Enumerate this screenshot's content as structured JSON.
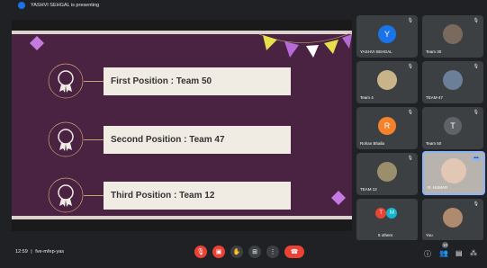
{
  "presenting": {
    "text": "YASHVI SEHGAL is presenting"
  },
  "slide": {
    "positions": [
      {
        "label": "First Position : Team 50",
        "numeral": "I"
      },
      {
        "label": "Second Position : Team 47",
        "numeral": "II"
      },
      {
        "label": "Third Position : Team 12",
        "numeral": "III"
      }
    ]
  },
  "participants": [
    {
      "name": "YASHVI SEHGAL",
      "initial": "Y",
      "color": "#1a73e8"
    },
    {
      "name": "Team 30",
      "initial": ""
    },
    {
      "name": "Team 4",
      "initial": ""
    },
    {
      "name": "TEAM-47",
      "initial": ""
    },
    {
      "name": "Rohan Bhalla",
      "initial": "R",
      "color": "#f4822a"
    },
    {
      "name": "Team 50",
      "initial": "T",
      "color": "#5f6368"
    },
    {
      "name": "TEAM 12",
      "initial": ""
    },
    {
      "name": "R. HUMAR",
      "initial": ""
    },
    {
      "name": "5 others",
      "initial_a": "T",
      "initial_b": "M"
    },
    {
      "name": "You",
      "initial": ""
    }
  ],
  "bottom": {
    "time": "12:59",
    "separator": "|",
    "meeting_code": "fve-mfep-yas",
    "people_count": "10"
  },
  "icons": {
    "mic": "mic-off-icon",
    "camera": "camera-off-icon",
    "hand": "raise-hand-icon",
    "present": "present-screen-icon",
    "more": "more-vert-icon",
    "end": "end-call-icon",
    "info": "info-icon",
    "people": "people-icon",
    "chat": "chat-icon",
    "activities": "activities-icon"
  },
  "colors": {
    "slide_bg": "#4a2343",
    "accent_red": "#ea4335",
    "highlight": "#8ab4f8"
  }
}
